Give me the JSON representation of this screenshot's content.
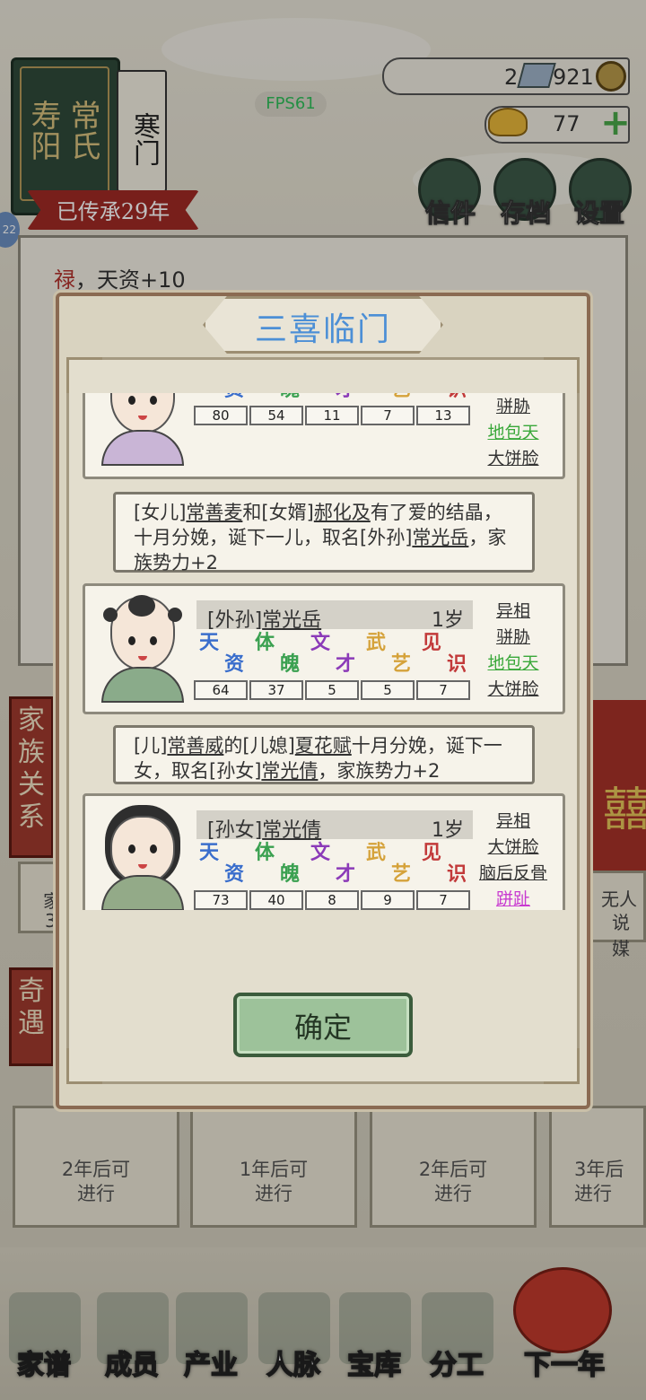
{
  "header": {
    "book_title": [
      "寿阳",
      "常氏"
    ],
    "book_title_cols": [
      "寿阳",
      "常氏"
    ],
    "clan_type": "寒门",
    "inherit": "已传承29年",
    "fps": "FPS61",
    "currency": "2",
    "currency2": "921",
    "gold": "77",
    "buttons": [
      "信件",
      "存档",
      "设置"
    ],
    "level_badge": "22"
  },
  "background": {
    "log_red": "禄",
    "log_text": "，天资+10",
    "side_tags": [
      "家族关系",
      "奇遇"
    ],
    "side_cards": [
      "家",
      "3",
      "无人",
      "说媒"
    ],
    "cards": [
      "2年后可\n进行",
      "1年后可\n进行",
      "2年后可\n进行",
      "3年后\n进行"
    ]
  },
  "modal": {
    "title": "三喜临门",
    "attr_labels": [
      [
        "天",
        "资"
      ],
      [
        "体",
        "魄"
      ],
      [
        "文",
        "才"
      ],
      [
        "武",
        "艺"
      ],
      [
        "见",
        "识"
      ]
    ],
    "attr_colors": [
      "#3a6ecc",
      "#3aa050",
      "#8b3ab8",
      "#d5a23a",
      "#c23a3a"
    ],
    "cards": [
      {
        "values": [
          "80",
          "54",
          "11",
          "7",
          "13"
        ],
        "traits": [
          "骈胁",
          "地包天",
          "大饼脸"
        ],
        "trait_colors": [
          "#333",
          "#3aa83a",
          "#333"
        ]
      },
      {
        "rel": "[外孙]",
        "name": "常光岳",
        "age": "1岁",
        "values": [
          "64",
          "37",
          "5",
          "5",
          "7"
        ],
        "traits": [
          "异相",
          "骈胁",
          "地包天",
          "大饼脸"
        ],
        "trait_colors": [
          "#333",
          "#333",
          "#3aa83a",
          "#333"
        ]
      },
      {
        "rel": "[孙女]",
        "name": "常光倩",
        "age": "1岁",
        "values": [
          "73",
          "40",
          "8",
          "9",
          "7"
        ],
        "traits": [
          "异相",
          "大饼脸",
          "脑后反骨",
          "跰趾"
        ],
        "trait_colors": [
          "#333",
          "#333",
          "#333",
          "#c83ad0"
        ]
      }
    ],
    "messages": [
      {
        "pre": "[女儿]",
        "n1": "常善麦",
        "mid": "和[女婿]",
        "n2": "郝化及",
        "post": "有了爱的结晶，十月分娩，诞下一儿，取名[外孙]",
        "n3": "常光岳",
        "end": "，家族势力+2"
      },
      {
        "pre": "[儿]",
        "n1": "常善威",
        "mid": "的[儿媳]",
        "n2": "夏花赋",
        "post": "十月分娩，诞下一女，取名[孙女]",
        "n3": "常光倩",
        "end": "，家族势力+2"
      }
    ],
    "confirm": "确定"
  },
  "nav": [
    "家谱",
    "成员",
    "产业",
    "人脉",
    "宝库",
    "分工",
    "下一年"
  ]
}
